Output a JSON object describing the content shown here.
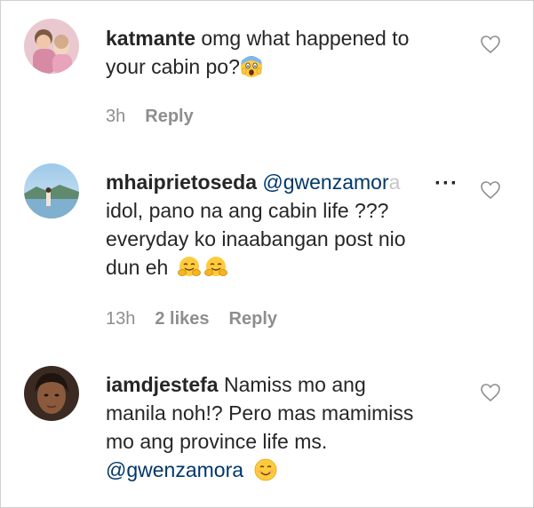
{
  "comments": [
    {
      "username": "katmante",
      "text_line1": "omg what happened to",
      "text_line2": "your cabin po?",
      "emoji": "screaming-face-emoji",
      "time": "3h",
      "likes": "",
      "reply": "Reply"
    },
    {
      "username": "mhaiprietoseda",
      "mention": "@gwenzamor",
      "mention_fade": "a",
      "text_line1": "idol, pano na ang cabin life ???",
      "text_line2": "everyday ko inaabangan post nio",
      "text_line3": "dun eh",
      "emoji": "hugging-face-emoji",
      "time": "13h",
      "likes": "2 likes",
      "reply": "Reply",
      "more_icon": "more-options-icon"
    },
    {
      "username": "iamdjestefa",
      "text_line1": "Namiss mo ang",
      "text_line2": "manila noh!? Pero mas mamimiss",
      "text_line3": "mo ang province life ms.",
      "mention": "@gwenzamora",
      "emoji": "smiling-face-emoji"
    }
  ],
  "colors": {
    "text": "#262626",
    "meta": "#8e8e8e",
    "mention": "#00376b"
  }
}
